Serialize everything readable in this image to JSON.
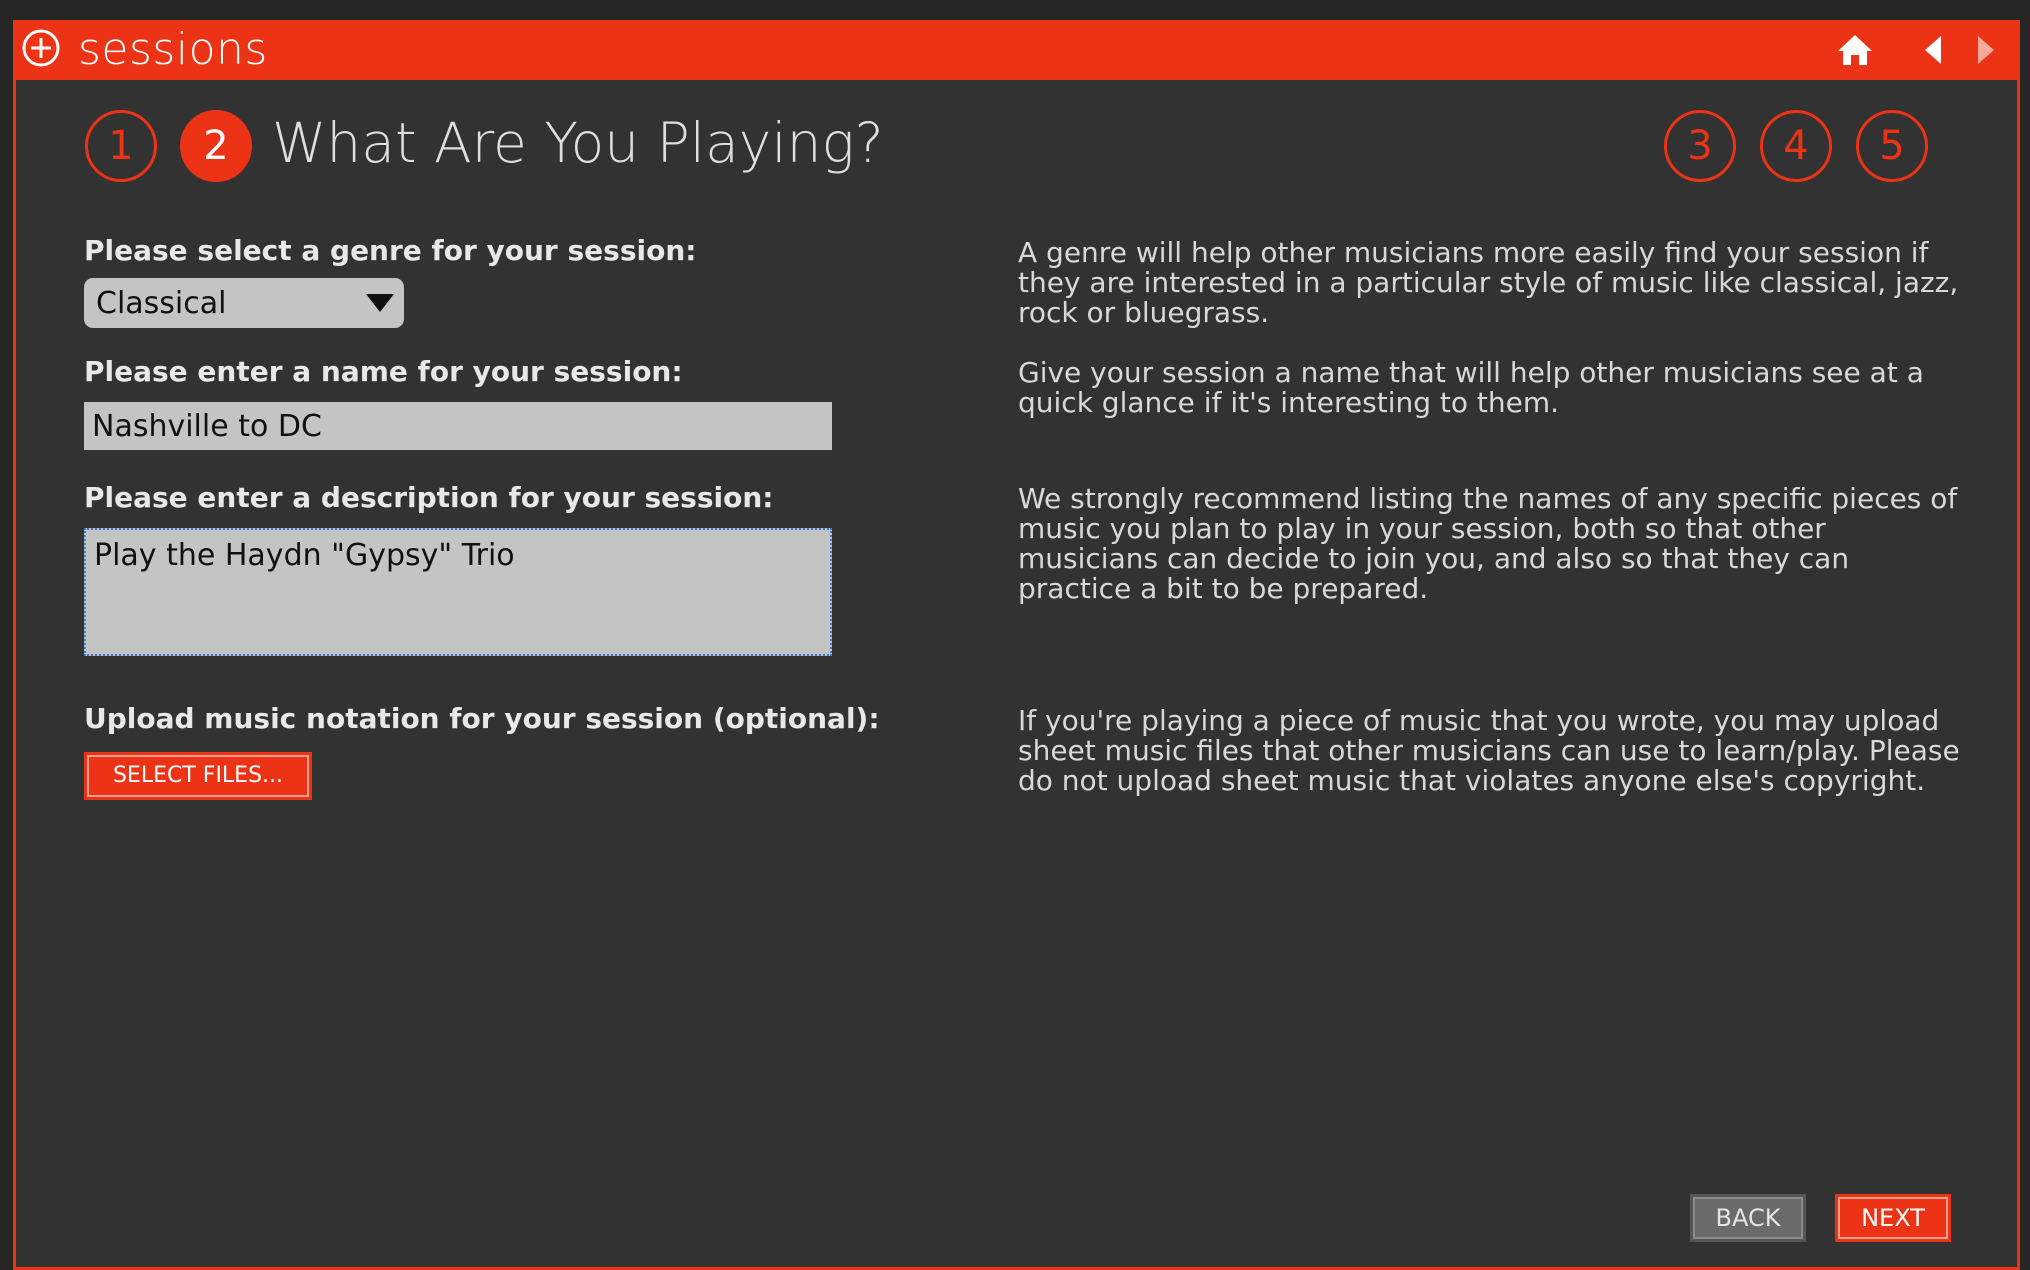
{
  "app": {
    "title": "sessions",
    "icons": [
      "add-circle-icon",
      "home-icon",
      "back-arrow-icon",
      "forward-arrow-icon"
    ],
    "accent_color": "#ec3316"
  },
  "steps": {
    "items": [
      "1",
      "2",
      "3",
      "4",
      "5"
    ],
    "active": "2",
    "title": "What Are You Playing?"
  },
  "form": {
    "genre": {
      "label": "Please select a genre for your session:",
      "value": "Classical",
      "help": "A genre will help other musicians more easily find your session if they are interested in a particular style of music like classical, jazz, rock or bluegrass."
    },
    "name": {
      "label": "Please enter a name for your session:",
      "value": "Nashville to DC",
      "help": "Give your session a name that will help other musicians see at a quick glance if it's interesting to them."
    },
    "description": {
      "label": "Please enter a description for your session:",
      "value": "Play the Haydn \"Gypsy\" Trio",
      "help": "We strongly recommend listing the names of any specific pieces of music you plan to play in your session, both so that other musicians can decide to join you, and also so that they can practice a bit to be prepared."
    },
    "upload": {
      "label": "Upload music notation for your session (optional):",
      "button_label": "SELECT FILES...",
      "help": "If you're playing a piece of music that you wrote, you may upload sheet music files that other musicians can use to learn/play. Please do not upload sheet music that violates anyone else's copyright."
    }
  },
  "footer": {
    "back_label": "BACK",
    "next_label": "NEXT"
  }
}
